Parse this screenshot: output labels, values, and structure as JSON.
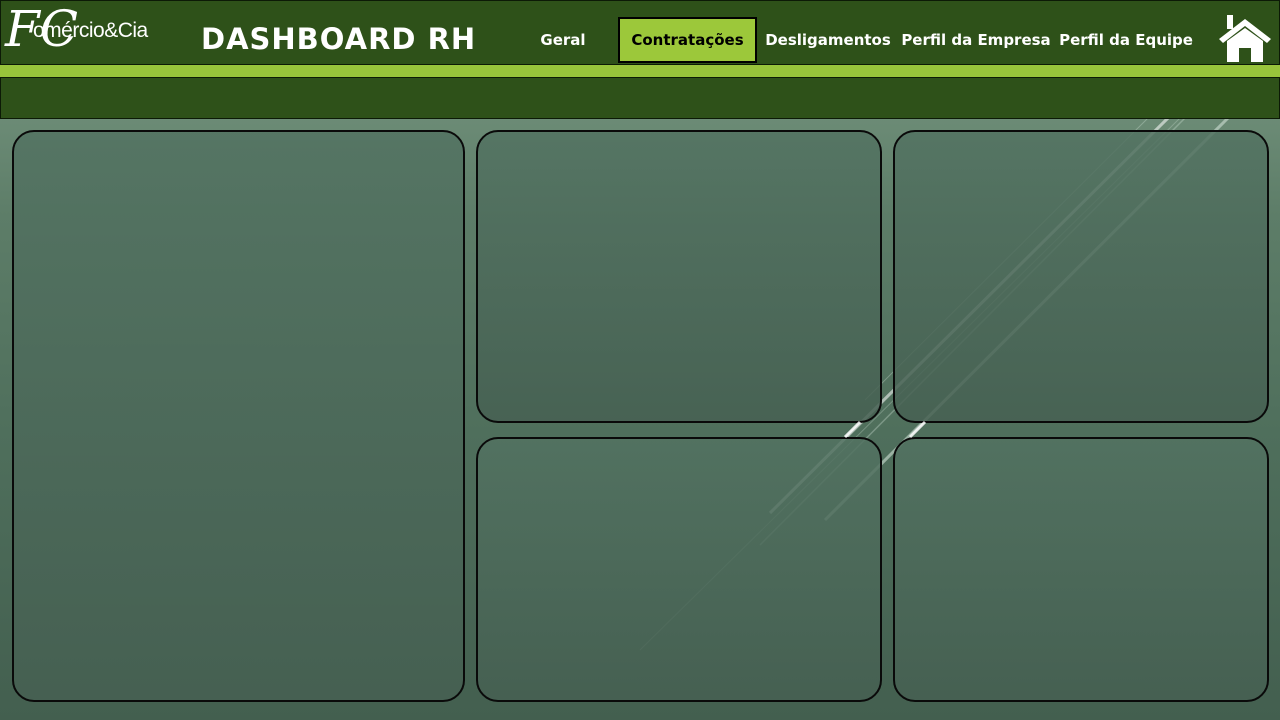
{
  "header": {
    "logo_monogram": "FC",
    "logo_text": "omércio&Cia",
    "title": "DASHBOARD RH",
    "tabs": [
      {
        "label": "Geral",
        "active": false
      },
      {
        "label": "Contratações",
        "active": true
      },
      {
        "label": "Desligamentos",
        "active": false
      },
      {
        "label": "Perfil da Empresa",
        "active": false
      },
      {
        "label": "Perfil da Equipe",
        "active": false
      }
    ],
    "home_icon": "home-icon"
  },
  "colors": {
    "header_bg": "#2e5119",
    "accent": "#98c43b",
    "active_tab": "#9cc83a",
    "background": "#4f6f5c"
  }
}
